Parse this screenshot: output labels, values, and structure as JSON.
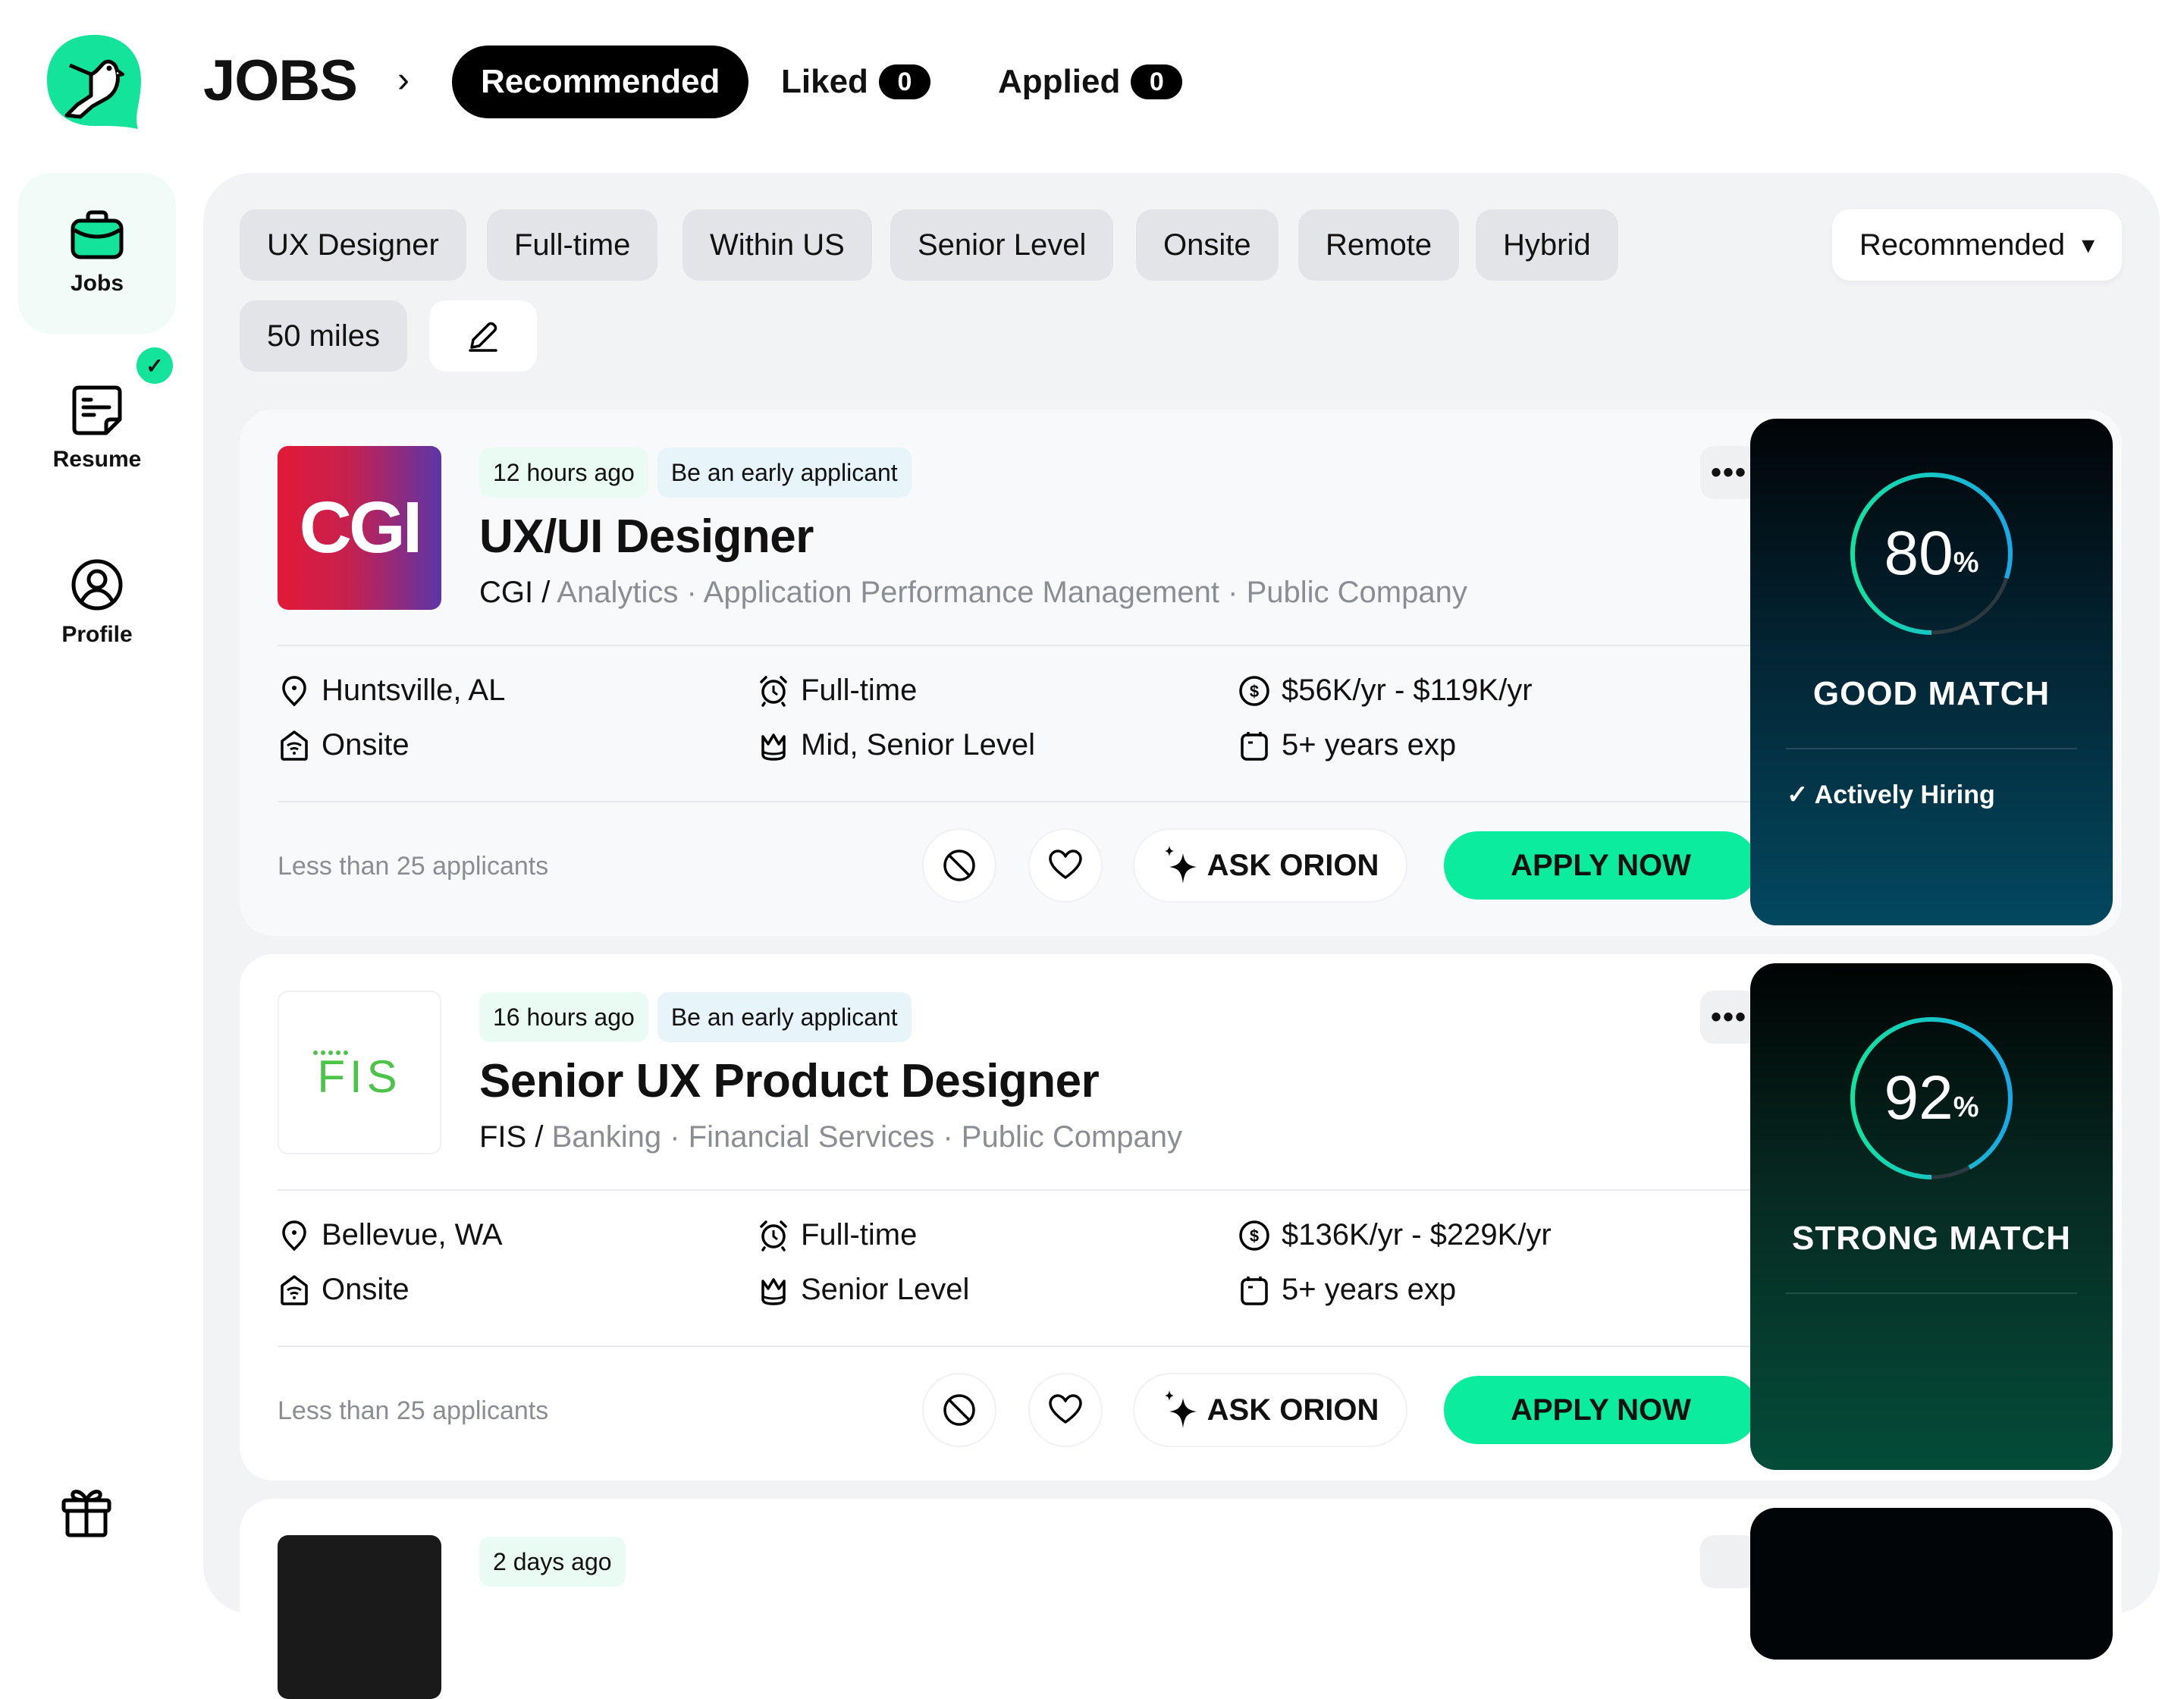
{
  "header": {
    "title": "JOBS",
    "separator": "›",
    "tabs": [
      {
        "label": "Recommended",
        "active": true
      },
      {
        "label": "Liked",
        "count": "0"
      },
      {
        "label": "Applied",
        "count": "0"
      }
    ]
  },
  "sidebar": {
    "items": [
      {
        "label": "Jobs",
        "icon": "briefcase-icon",
        "active": true
      },
      {
        "label": "Resume",
        "icon": "resume-icon",
        "badge": "✓"
      },
      {
        "label": "Profile",
        "icon": "profile-icon"
      }
    ],
    "bottom_icon": "gift-icon"
  },
  "filters": {
    "chips": [
      "UX Designer",
      "Full-time",
      "Within US",
      "Senior Level",
      "Onsite",
      "Remote",
      "Hybrid",
      "50 miles"
    ],
    "edit_icon": "pencil-icon",
    "sort": {
      "selected": "Recommended",
      "caret": "▾"
    }
  },
  "jobs": [
    {
      "posted": "12 hours ago",
      "tag": "Be an early applicant",
      "logo_text": "CGI",
      "title": "UX/UI Designer",
      "company": "CGI",
      "company_sep": " / ",
      "industries": "Analytics · Application Performance Management · Public Company",
      "location": "Huntsville, AL",
      "work_mode": "Onsite",
      "employment": "Full-time",
      "level": "Mid, Senior Level",
      "salary": "$56K/yr - $119K/yr",
      "experience": "5+ years exp",
      "applicants": "Less than 25 applicants",
      "ask_label": "ASK ORION",
      "apply_label": "APPLY NOW",
      "more": "•••",
      "match": {
        "percent": 80,
        "number": "80",
        "pct_sign": "%",
        "label": "GOOD MATCH",
        "extra": "✓ Actively Hiring"
      }
    },
    {
      "posted": "16 hours ago",
      "tag": "Be an early applicant",
      "logo_text": "FIS",
      "title": "Senior UX Product Designer",
      "company": "FIS",
      "company_sep": " / ",
      "industries": "Banking · Financial Services · Public Company",
      "location": "Bellevue, WA",
      "work_mode": "Onsite",
      "employment": "Full-time",
      "level": "Senior Level",
      "salary": "$136K/yr - $229K/yr",
      "experience": "5+ years exp",
      "applicants": "Less than 25 applicants",
      "ask_label": "ASK ORION",
      "apply_label": "APPLY NOW",
      "more": "•••",
      "match": {
        "percent": 92,
        "number": "92",
        "pct_sign": "%",
        "label": "STRONG MATCH",
        "extra": ""
      }
    },
    {
      "posted": "2 days ago"
    }
  ],
  "colors": {
    "accent": "#0cec9e",
    "ring_start": "#12e3a0",
    "ring_end": "#1aa8e6",
    "ring_track": "#2c3a40"
  }
}
